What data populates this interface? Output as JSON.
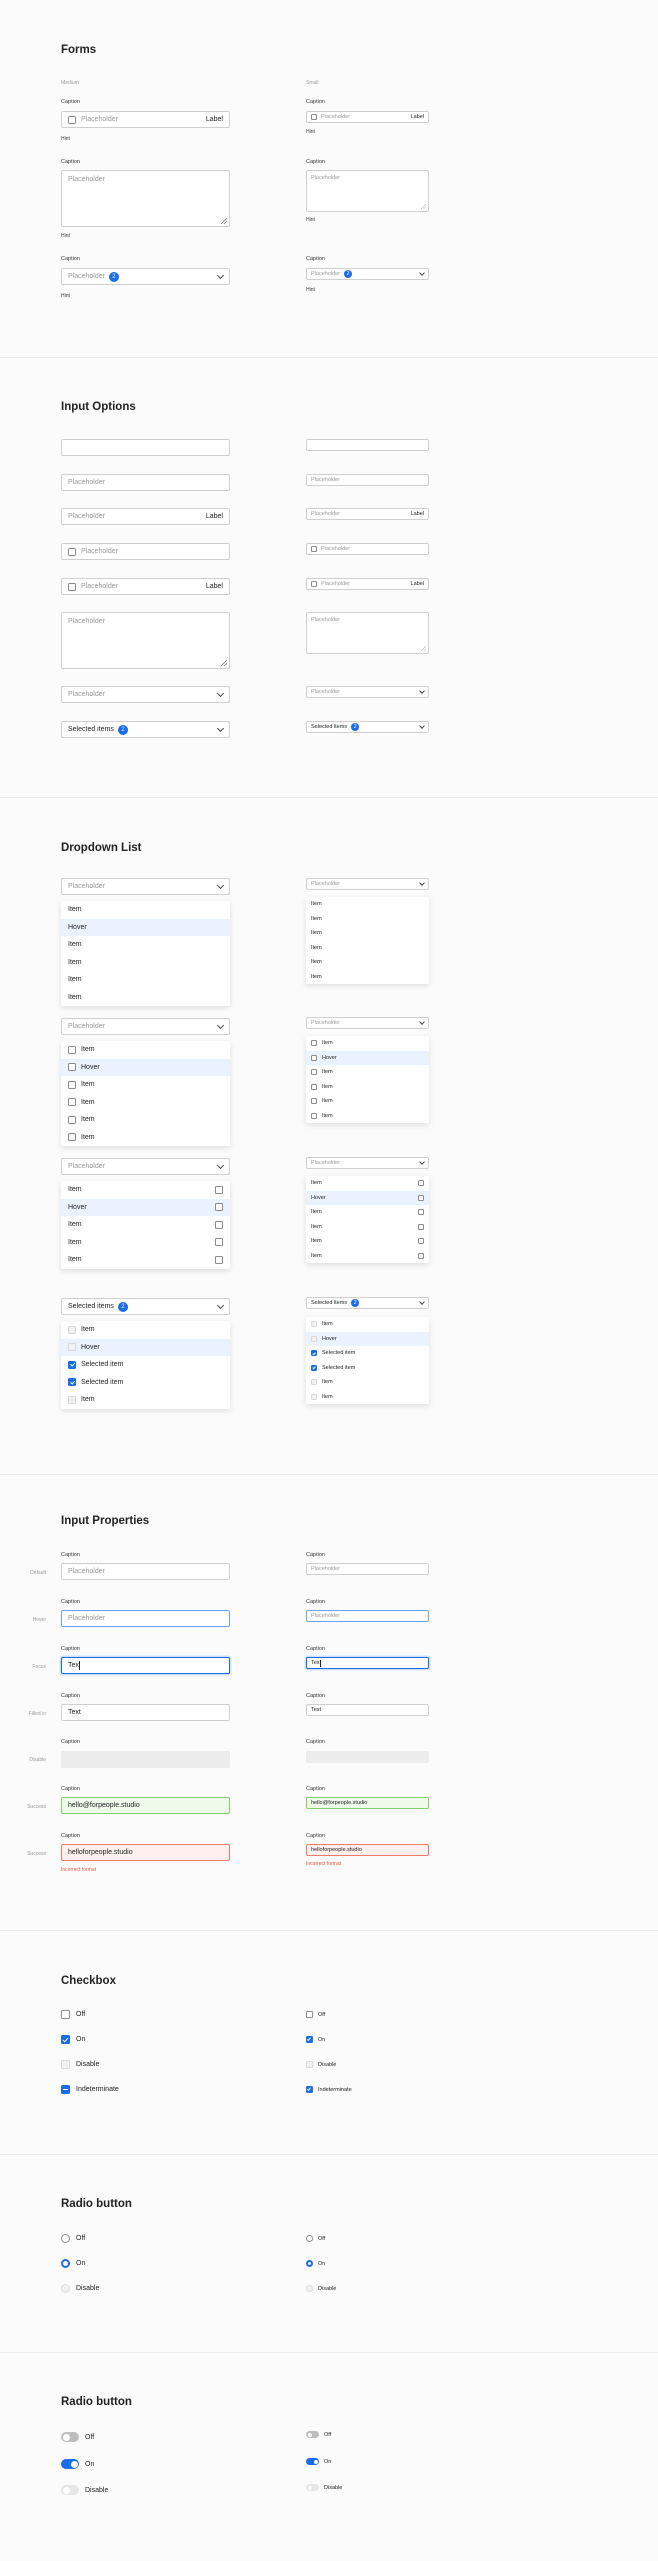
{
  "forms": {
    "title": "Forms",
    "medium_label": "Medium",
    "small_label": "Small",
    "caption": "Caption",
    "placeholder": "Placeholder",
    "label": "Label",
    "hint": "Hint",
    "badge": "2"
  },
  "input_options": {
    "title": "Input Options",
    "placeholder": "Placeholder",
    "label": "Label",
    "selected_items": "Selected items",
    "badge": "2"
  },
  "dropdown_list": {
    "title": "Dropdown List",
    "placeholder": "Placeholder",
    "selected_items": "Selected items",
    "badge": "2",
    "items": [
      "Item",
      "Hover",
      "Item",
      "Item",
      "Item",
      "Item"
    ],
    "multi_items": [
      "Item",
      "Hover",
      "Selected item",
      "Selected item",
      "Item"
    ]
  },
  "input_properties": {
    "title": "Input Properties",
    "caption": "Caption",
    "states": [
      "Default",
      "Hover",
      "Focus",
      "Filled in",
      "Disable",
      "Success",
      "Success"
    ],
    "placeholder": "Placeholder",
    "focus_text": "Tex",
    "filled_text": "Text",
    "success_text": "hello@forpeople.studio",
    "error_text": "helloforpeople.studio",
    "error_message": "Incorrect format"
  },
  "checkbox": {
    "title": "Checkbox",
    "options": [
      "Off",
      "On",
      "Disable",
      "Indeterminate"
    ]
  },
  "radio": {
    "title": "Radio button",
    "options": [
      "Off",
      "On",
      "Disable"
    ]
  },
  "toggle": {
    "title": "Radio button",
    "options": [
      "Off",
      "On",
      "Disable"
    ]
  },
  "colors": {
    "accent": "#1a6ce8",
    "success": "#7fcf6b",
    "error": "#e5533c"
  }
}
